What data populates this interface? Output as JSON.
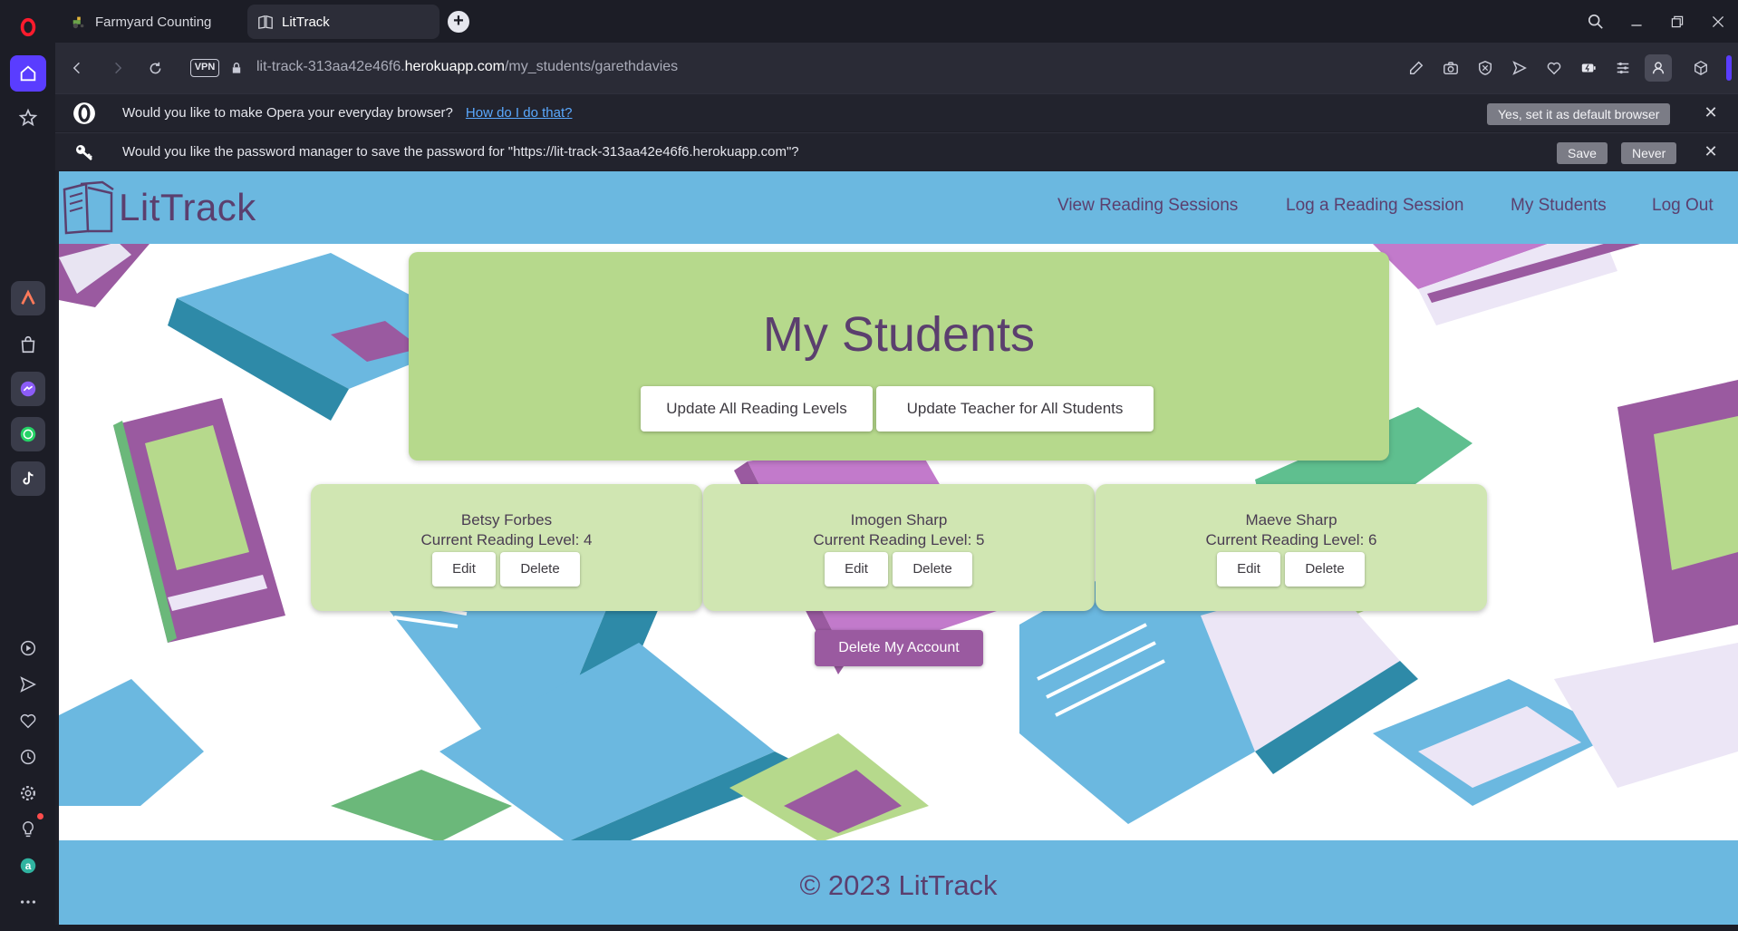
{
  "browser": {
    "tabs": [
      {
        "label": "Farmyard Counting",
        "active": false
      },
      {
        "label": "LitTrack",
        "active": true
      }
    ],
    "address": {
      "prefix": "lit-track-313aa42e46f6.",
      "host": "herokuapp.com",
      "path": "/my_students/garethdavies"
    },
    "vpn_label": "VPN",
    "infobar_default": {
      "message": "Would you like to make Opera your everyday browser?",
      "link": "How do I do that?",
      "button": "Yes, set it as default browser"
    },
    "infobar_password": {
      "message": "Would you like the password manager to save the password for \"https://lit-track-313aa42e46f6.herokuapp.com\"?",
      "save_button": "Save",
      "never_button": "Never"
    },
    "accent_color": "#5a3dff"
  },
  "site": {
    "logo_text": "LitTrack",
    "nav": [
      "View Reading Sessions",
      "Log a Reading Session",
      "My Students",
      "Log Out"
    ],
    "title": "My Students",
    "buttons": {
      "update_levels": "Update All Reading Levels",
      "update_teacher": "Update Teacher for All Students"
    },
    "students": [
      {
        "name": "Betsy Forbes",
        "level": "Current Reading Level: 4"
      },
      {
        "name": "Imogen Sharp",
        "level": "Current Reading Level: 5"
      },
      {
        "name": "Maeve Sharp",
        "level": "Current Reading Level: 6"
      }
    ],
    "edit_label": "Edit",
    "delete_label": "Delete",
    "delete_account": "Delete My Account",
    "footer": "© 2023 LitTrack",
    "colors": {
      "header": "#6bb8e0",
      "hero": "#b6d98c",
      "card": "#d0e6b2",
      "text": "#5b3f6e",
      "danger": "#9a5aa0"
    }
  }
}
